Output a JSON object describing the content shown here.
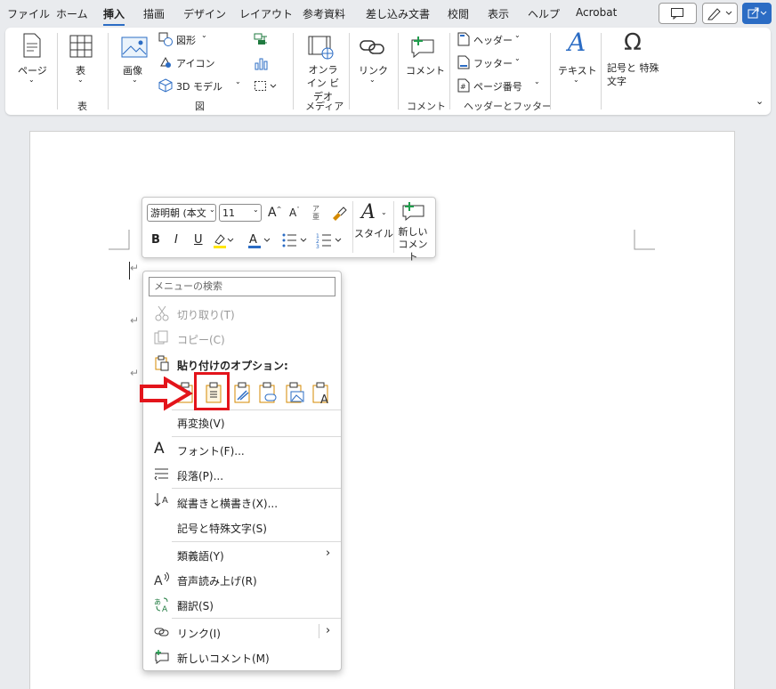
{
  "tabs": [
    "ファイル",
    "ホーム",
    "挿入",
    "描画",
    "デザイン",
    "レイアウト",
    "参考資料",
    "差し込み文書",
    "校閲",
    "表示",
    "ヘルプ",
    "Acrobat"
  ],
  "active_tab": "挿入",
  "ribbon": {
    "page": "ページ",
    "table": "表",
    "image": "画像",
    "shapes": "図形",
    "icons": "アイコン",
    "models3d": "3D モデル",
    "online_video": "オンライン ビデオ",
    "link": "リンク",
    "comment": "コメント",
    "header": "ヘッダー",
    "footer": "フッター",
    "page_number": "ページ番号",
    "text": "テキスト",
    "symbols": "記号と 特殊文字",
    "groups": {
      "table": "表",
      "figure": "図",
      "media": "メディア",
      "comment": "コメント",
      "header_footer": "ヘッダーとフッター"
    }
  },
  "mini_toolbar": {
    "font": "游明朝 (本文",
    "size": "11",
    "styles": "スタイル",
    "new_comment": "新しい コメント"
  },
  "context_menu": {
    "search_placeholder": "メニューの検索",
    "cut": "切り取り(T)",
    "copy": "コピー(C)",
    "paste_options": "貼り付けのオプション:",
    "reconvert": "再変換(V)",
    "font": "フォント(F)...",
    "paragraph": "段落(P)...",
    "vertical_horizontal": "縦書きと横書き(X)...",
    "symbols": "記号と特殊文字(S)",
    "synonyms": "類義語(Y)",
    "read_aloud": "音声読み上げ(R)",
    "translate": "翻訳(S)",
    "link": "リンク(I)",
    "new_comment": "新しいコメント(M)"
  },
  "colors": {
    "accent": "#2b6cc4",
    "highlight_box": "#e3141b",
    "arrow": "#e3141b",
    "paste_orange": "#d48a00"
  }
}
